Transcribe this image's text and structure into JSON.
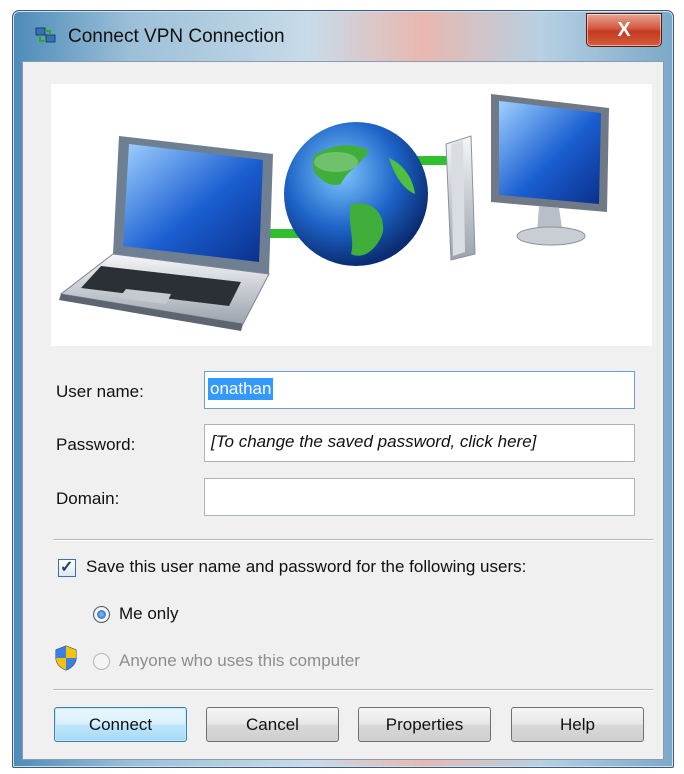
{
  "window": {
    "title": "Connect VPN Connection",
    "close_label": "X"
  },
  "form": {
    "username_label": "User name:",
    "username_value": "onathan",
    "password_label": "Password:",
    "password_hint": "[To change the saved password, click here]",
    "domain_label": "Domain:",
    "domain_value": ""
  },
  "save": {
    "label": "Save this user name and password for the following users:",
    "checked": true,
    "options": [
      {
        "label": "Me only",
        "selected": true,
        "enabled": true
      },
      {
        "label": "Anyone who uses this computer",
        "selected": false,
        "enabled": false
      }
    ]
  },
  "buttons": {
    "connect": "Connect",
    "cancel": "Cancel",
    "properties": "Properties",
    "help": "Help"
  },
  "icons": {
    "title": "network-connection-icon",
    "banner": "vpn-illustration",
    "shield": "uac-shield-icon"
  },
  "colors": {
    "accent": "#3399ff",
    "close": "#c33a1f",
    "link_line": "#2fbf2f"
  }
}
